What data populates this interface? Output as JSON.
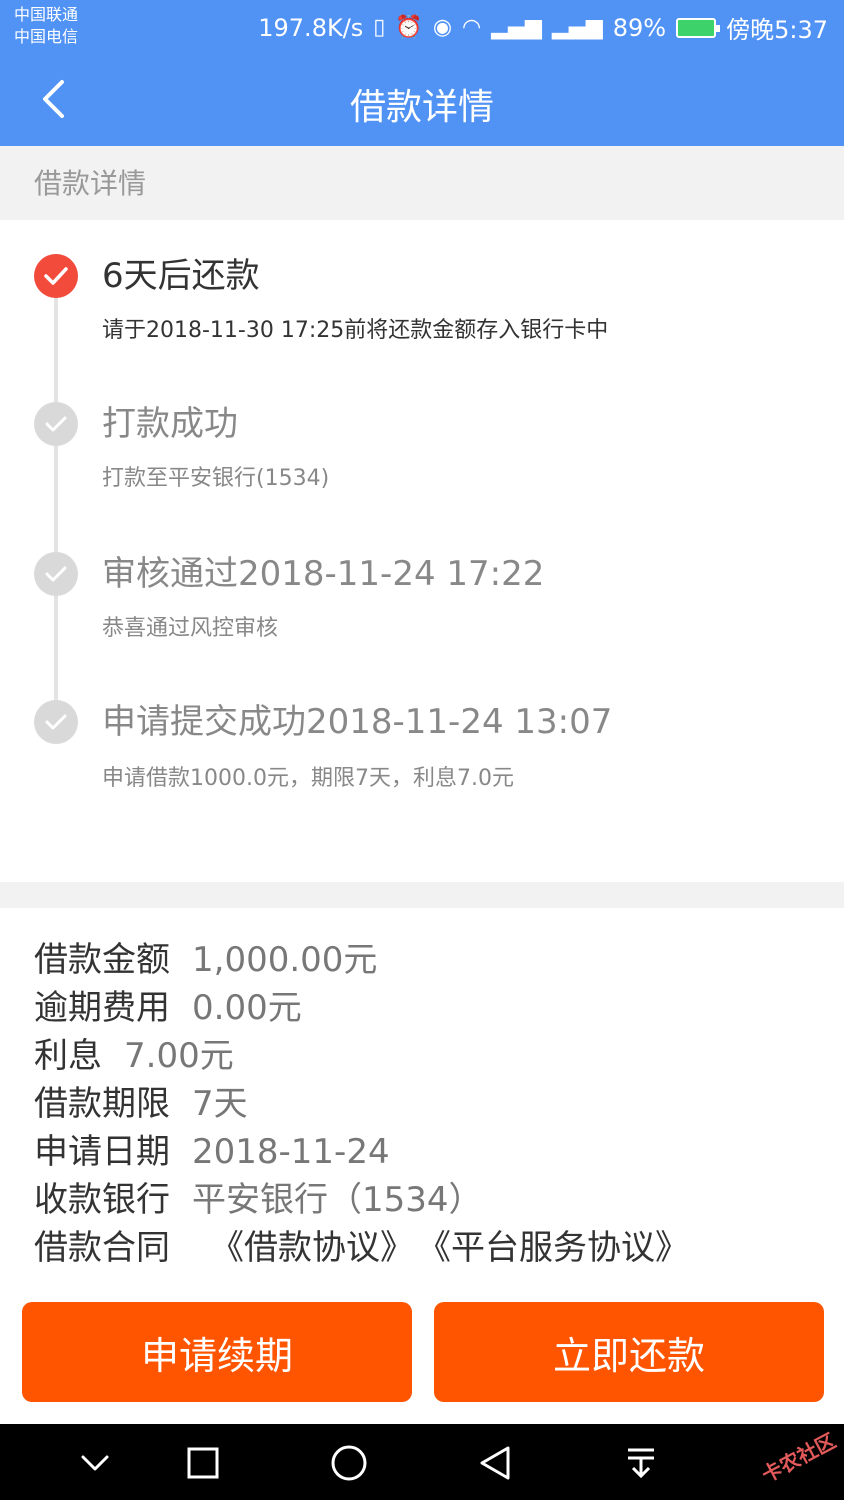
{
  "status_bar": {
    "carrier_1": "中国联通",
    "carrier_2": "中国电信",
    "speed": "197.8K/s",
    "battery": "89%",
    "time": "傍晚5:37"
  },
  "header": {
    "title": "借款详情",
    "back_icon": "chevron-left-icon",
    "background_color": "#5193f5"
  },
  "section": {
    "label": "借款详情"
  },
  "timeline": [
    {
      "title": "6天后还款",
      "subtitle": "请于2018-11-30 17:25前将还款金额存入银行卡中",
      "state": "active"
    },
    {
      "title": "打款成功",
      "subtitle": "打款至平安银行(1534)",
      "state": "done"
    },
    {
      "title": "审核通过2018-11-24 17:22",
      "subtitle": "恭喜通过风控审核",
      "state": "done"
    },
    {
      "title": "申请提交成功2018-11-24 13:07",
      "subtitle": "申请借款1000.0元，期限7天，利息7.0元",
      "state": "done"
    }
  ],
  "details": {
    "amount_label": "借款金额",
    "amount_value": "1,000.00元",
    "overdue_label": "逾期费用",
    "overdue_value": "0.00元",
    "interest_label": "利息",
    "interest_value": "7.00元",
    "term_label": "借款期限",
    "term_value": "7天",
    "date_label": "申请日期",
    "date_value": "2018-11-24",
    "bank_label": "收款银行",
    "bank_value": "平安银行（1534）",
    "contract_label": "借款合同",
    "contract_link_1": "《借款协议》",
    "contract_link_2": "《平台服务协议》"
  },
  "actions": {
    "extend_label": "申请续期",
    "repay_label": "立即还款",
    "button_color": "#ff5400"
  },
  "system_nav": {
    "icons": [
      "chevron-down-icon",
      "square-icon",
      "circle-icon",
      "triangle-back-icon",
      "download-icon"
    ]
  },
  "watermark": "卡农社区"
}
